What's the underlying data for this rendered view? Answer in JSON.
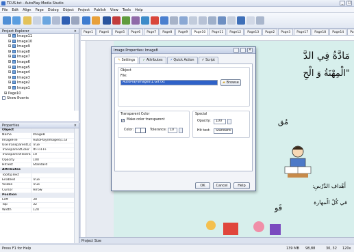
{
  "window": {
    "title": "TCUS.txt - AutoPlay Media Studio"
  },
  "menu": [
    "File",
    "Edit",
    "Align",
    "Page",
    "Dialog",
    "Object",
    "Project",
    "Publish",
    "View",
    "Tools",
    "Help"
  ],
  "explorer": {
    "title": "Project Explorer",
    "items": [
      "Image11",
      "Image10",
      "Image9",
      "Image8",
      "Image7",
      "Image6",
      "Image5",
      "Image4",
      "Image3",
      "Image2",
      "Image1"
    ],
    "page_item": "Page10",
    "show_events": "Show Events"
  },
  "properties": {
    "title": "Properties",
    "rows": [
      {
        "key": "Object",
        "value": "",
        "category": true
      },
      {
        "key": "Name",
        "value": "Image8"
      },
      {
        "key": "ImageFile",
        "value": "AutoPlay\\Images\\1.GI"
      },
      {
        "key": "UseTransparentColor",
        "value": "True"
      },
      {
        "key": "TransparentColor",
        "value": "#FFFFFF"
      },
      {
        "key": "TransparentTolerance",
        "value": "10"
      },
      {
        "key": "Opacity",
        "value": "100"
      },
      {
        "key": "HitTest",
        "value": "Standard"
      },
      {
        "key": "Attributes",
        "value": "",
        "category": true
      },
      {
        "key": "TooltipText",
        "value": ""
      },
      {
        "key": "Enabled",
        "value": "True"
      },
      {
        "key": "Visible",
        "value": "True"
      },
      {
        "key": "Cursor",
        "value": "Arrow"
      },
      {
        "key": "Position",
        "value": "",
        "category": true
      },
      {
        "key": "Left",
        "value": "30"
      },
      {
        "key": "Top",
        "value": "32"
      },
      {
        "key": "Width",
        "value": "120"
      }
    ]
  },
  "page_tabs": [
    "Page1",
    "Page4",
    "Page5",
    "Page6",
    "Page7",
    "Page8",
    "Page9",
    "Page10",
    "Page11",
    "Page12",
    "Page13",
    "Page2",
    "Page3",
    "Page17",
    "Page18",
    "Page14",
    "Page"
  ],
  "active_tab": "Page10",
  "canvas_text": {
    "line1": "مَادَّةُ فِي الدَّ",
    "line2": "\"الْمِهْنَةُ وَ الْحِ",
    "line3": "مُق",
    "line4": "قَو",
    "line5": "أَهْداف الدَّرْسِ:",
    "line6": "في كُلّ الْمهارة"
  },
  "dialog": {
    "title": "Image Properties: Image8",
    "tabs": [
      "Settings",
      "Attributes",
      "Quick Action",
      "Script"
    ],
    "object_label": "Object",
    "file_label": "File:",
    "file_value": "AutoPlay\\Images\\1.GIF.txt",
    "browse": "Browse",
    "transparent_group": "Transparent Color",
    "make_transparent": "Make color transparent",
    "color_label": "Color:",
    "tolerance_label": "Tolerance:",
    "tolerance_value": "10",
    "special_group": "Special",
    "opacity_label": "Opacity:",
    "opacity_value": "100",
    "hittest_label": "Hit test:",
    "hittest_value": "Standard",
    "ok": "OK",
    "cancel": "Cancel",
    "help": "Help"
  },
  "project_size": "Project Size",
  "status": {
    "left": "Press F1 for Help",
    "size": "139 MB",
    "files": "98,88",
    "coords": "30, 32",
    "dims": "120x"
  }
}
